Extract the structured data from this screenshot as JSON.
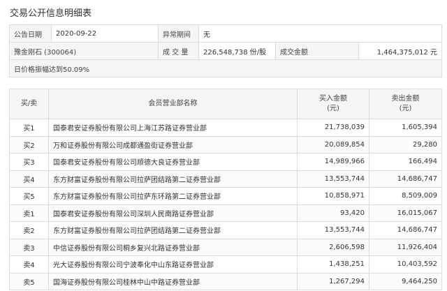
{
  "page_title": "交易公开信息明细表",
  "info": {
    "date_label": "公告日期",
    "date_value": "2020-09-22",
    "abnormal_label": "异常期间",
    "abnormal_value": "无",
    "stock": "豫金刚石 (300064)",
    "volume_label": "成 交 量",
    "volume_value": "226,548,738 份/股",
    "amount_label": "成交金额",
    "amount_value": "1,464,375,012 元",
    "reason": "日价格振幅达到50.09%"
  },
  "detail": {
    "headers": {
      "side": "买/卖",
      "name": "会员营业部名称",
      "buy_line1": "买入金额",
      "buy_line2": "(元)",
      "sell_line1": "卖出金额",
      "sell_line2": "(元)"
    },
    "rows": [
      {
        "side": "买1",
        "name": "国泰君安证券股份有限公司上海江苏路证券营业部",
        "buy": "21,738,039",
        "sell": "1,605,394"
      },
      {
        "side": "买2",
        "name": "万和证券股份有限公司成都通盈街证券营业部",
        "buy": "20,089,854",
        "sell": "29,280"
      },
      {
        "side": "买3",
        "name": "国泰君安证券股份有限公司顺德大良证券营业部",
        "buy": "14,989,966",
        "sell": "166,494"
      },
      {
        "side": "买4",
        "name": "东方财富证券股份有限公司拉萨团结路第二证券营业部",
        "buy": "13,553,744",
        "sell": "14,686,747"
      },
      {
        "side": "买5",
        "name": "东方财富证券股份有限公司拉萨东环路第二证券营业部",
        "buy": "10,858,971",
        "sell": "8,509,009"
      },
      {
        "side": "卖1",
        "name": "国泰君安证券股份有限公司深圳人民南路证券营业部",
        "buy": "93,420",
        "sell": "16,015,067"
      },
      {
        "side": "卖2",
        "name": "东方财富证券股份有限公司拉萨团结路第二证券营业部",
        "buy": "13,553,744",
        "sell": "14,686,747"
      },
      {
        "side": "卖3",
        "name": "中信证券股份有限公司桐乡复兴北路证券营业部",
        "buy": "2,606,598",
        "sell": "11,926,404"
      },
      {
        "side": "卖4",
        "name": "光大证券股份有限公司宁波奉化中山东路证券营业部",
        "buy": "1,438,251",
        "sell": "10,403,592"
      },
      {
        "side": "卖5",
        "name": "国海证券股份有限公司桂林中山中路证券营业部",
        "buy": "1,267,294",
        "sell": "9,464,250"
      }
    ]
  }
}
